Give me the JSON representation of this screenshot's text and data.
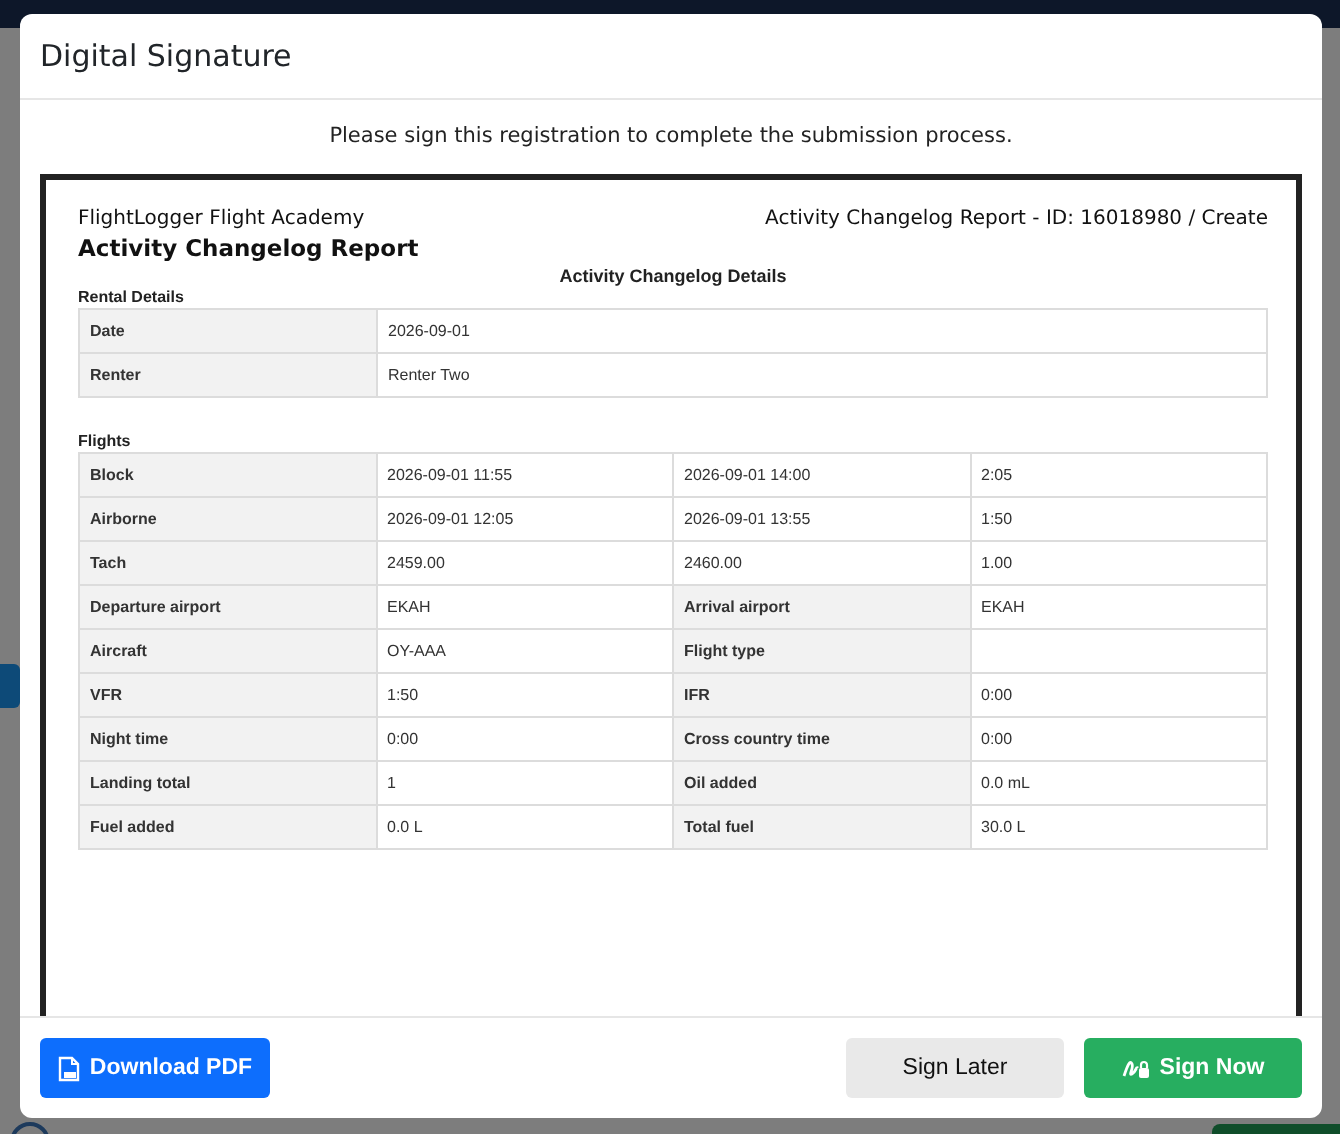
{
  "dialog": {
    "title": "Digital Signature",
    "instruction": "Please sign this registration to complete the submission process."
  },
  "document": {
    "organization": "FlightLogger Flight Academy",
    "reference": "Activity Changelog Report - ID: 16018980 / Create",
    "title": "Activity Changelog Report",
    "section_title": "Activity Changelog Details",
    "rental": {
      "heading": "Rental Details",
      "rows": [
        [
          {
            "kind": "label",
            "text": "Date"
          },
          {
            "kind": "value",
            "text": "2026-09-01"
          }
        ],
        [
          {
            "kind": "label",
            "text": "Renter"
          },
          {
            "kind": "value",
            "text": "Renter Two"
          }
        ]
      ]
    },
    "flights": {
      "heading": "Flights",
      "rows": [
        [
          {
            "kind": "label",
            "text": "Block"
          },
          {
            "kind": "value",
            "text": "2026-09-01 11:55"
          },
          {
            "kind": "value",
            "text": "2026-09-01 14:00"
          },
          {
            "kind": "value",
            "text": "2:05"
          }
        ],
        [
          {
            "kind": "label",
            "text": "Airborne"
          },
          {
            "kind": "value",
            "text": "2026-09-01 12:05"
          },
          {
            "kind": "value",
            "text": "2026-09-01 13:55"
          },
          {
            "kind": "value",
            "text": "1:50"
          }
        ],
        [
          {
            "kind": "label",
            "text": "Tach"
          },
          {
            "kind": "value",
            "text": "2459.00"
          },
          {
            "kind": "value",
            "text": "2460.00"
          },
          {
            "kind": "value",
            "text": "1.00"
          }
        ],
        [
          {
            "kind": "label",
            "text": "Departure airport"
          },
          {
            "kind": "value",
            "text": "EKAH"
          },
          {
            "kind": "label",
            "text": "Arrival airport"
          },
          {
            "kind": "value",
            "text": "EKAH"
          }
        ],
        [
          {
            "kind": "label",
            "text": "Aircraft"
          },
          {
            "kind": "value",
            "text": "OY-AAA"
          },
          {
            "kind": "label",
            "text": "Flight type"
          },
          {
            "kind": "value"
          }
        ],
        [
          {
            "kind": "label",
            "text": "VFR"
          },
          {
            "kind": "value",
            "text": "1:50"
          },
          {
            "kind": "label",
            "text": "IFR"
          },
          {
            "kind": "value",
            "text": "0:00"
          }
        ],
        [
          {
            "kind": "label",
            "text": "Night time"
          },
          {
            "kind": "value",
            "text": "0:00"
          },
          {
            "kind": "label",
            "text": "Cross country time"
          },
          {
            "kind": "value",
            "text": "0:00"
          }
        ],
        [
          {
            "kind": "label",
            "text": "Landing total"
          },
          {
            "kind": "value",
            "text": "1"
          },
          {
            "kind": "label",
            "text": "Oil added"
          },
          {
            "kind": "value",
            "text": "0.0 mL"
          }
        ],
        [
          {
            "kind": "label",
            "text": "Fuel added"
          },
          {
            "kind": "value",
            "text": "0.0 L"
          },
          {
            "kind": "label",
            "text": "Total fuel"
          },
          {
            "kind": "value",
            "text": "30.0 L"
          }
        ]
      ]
    }
  },
  "buttons": {
    "download": "Download PDF",
    "later": "Sign Later",
    "sign": "Sign Now"
  }
}
